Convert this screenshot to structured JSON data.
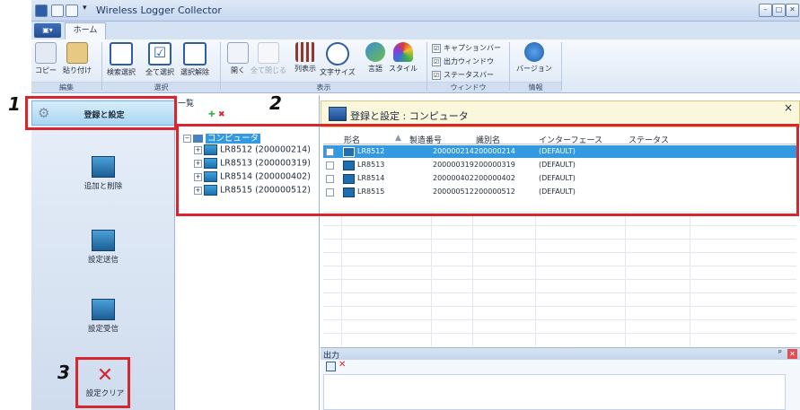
{
  "window": {
    "title": "Wireless Logger Collector",
    "controls": [
      "–",
      "□",
      "✕"
    ]
  },
  "ribbon": {
    "file_label": "▣▾",
    "tab_home": "ホーム",
    "buttons": {
      "copy": "コピー",
      "paste": "貼り付け",
      "search_select": "検索選択",
      "select_all": "全て選択",
      "deselect": "選択解除",
      "open": "開く",
      "close_all": "全て閉じる",
      "column_display": "列表示",
      "font_size": "文字サイズ",
      "language": "言語",
      "style": "スタイル",
      "version": "バージョン"
    },
    "checks": {
      "caption_bar": "キャプションバー",
      "output_window": "出力ウィンドウ",
      "status_bar": "ステータスバー",
      "check_mark": "☑"
    },
    "groups": {
      "edit": "編集",
      "select": "選択",
      "display": "表示",
      "window": "ウィンドウ",
      "info": "情報"
    }
  },
  "nav": {
    "register": "登録と設定",
    "add_remove": "追加と削除",
    "send": "設定送信",
    "receive": "設定受信",
    "clear": "設定クリア"
  },
  "tree": {
    "title": "一覧",
    "root": "コンピュータ",
    "nodes": [
      "LR8512 (200000214)",
      "LR8513 (200000319)",
      "LR8514 (200000402)",
      "LR8515 (200000512)"
    ]
  },
  "main": {
    "header_title": "登録と設定 : コンピュータ",
    "close": "×",
    "columns": [
      "形名",
      "製造番号",
      "識別名",
      "インターフェース",
      "ステータス"
    ],
    "rows": [
      {
        "model": "LR8512",
        "serial": "200000214",
        "id": "200000214",
        "iface": "(DEFAULT)",
        "status": ""
      },
      {
        "model": "LR8513",
        "serial": "200000319",
        "id": "200000319",
        "iface": "(DEFAULT)",
        "status": ""
      },
      {
        "model": "LR8514",
        "serial": "200000402",
        "id": "200000402",
        "iface": "(DEFAULT)",
        "status": ""
      },
      {
        "model": "LR8515",
        "serial": "200000512",
        "id": "200000512",
        "iface": "(DEFAULT)",
        "status": ""
      }
    ],
    "selected_row": 0
  },
  "output": {
    "title": "出力",
    "pin": "ᵖ",
    "close": "✕",
    "clear": "✕"
  },
  "annotations": [
    "1",
    "2",
    "3"
  ],
  "colors": {
    "accent": "#d8262e",
    "selection": "#3399e0",
    "nav_active": "#bfe3f8"
  }
}
